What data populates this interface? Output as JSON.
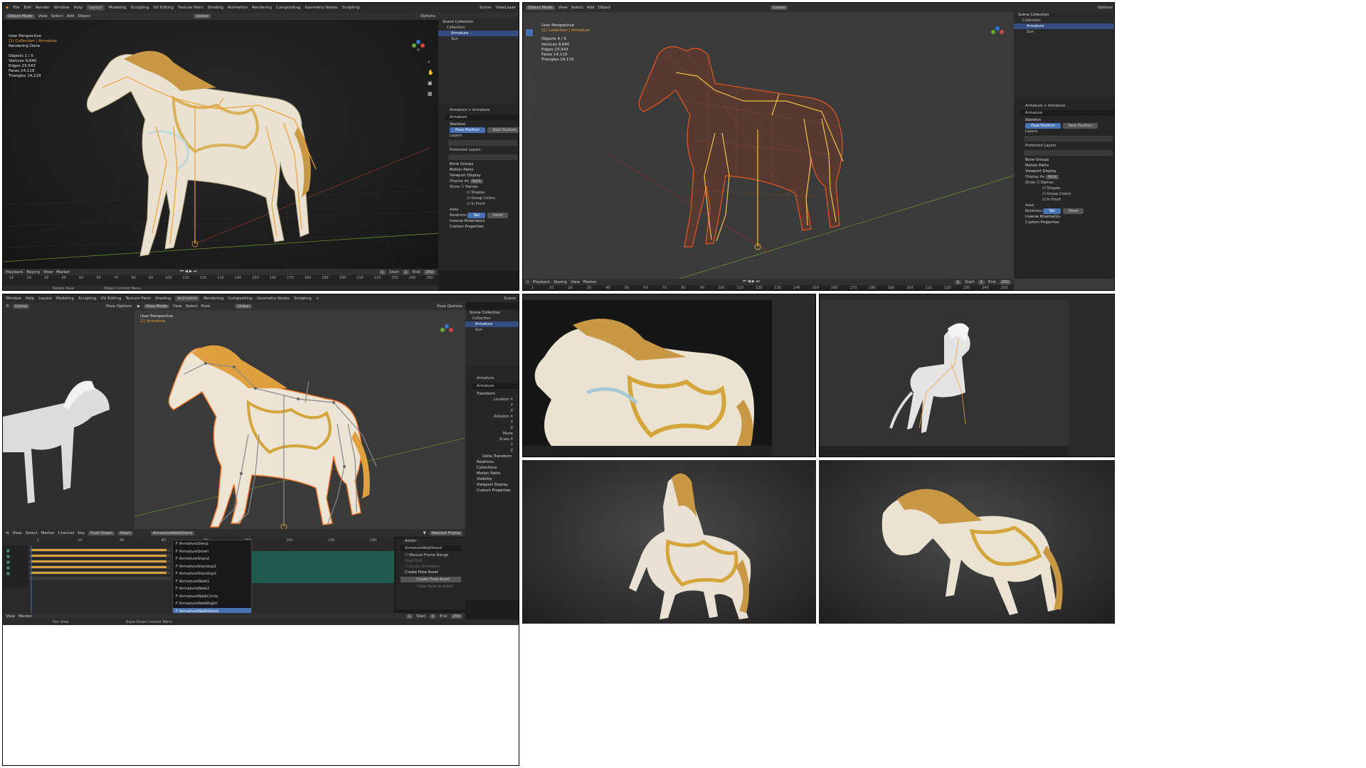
{
  "panel1": {
    "menu": [
      "File",
      "Edit",
      "Render",
      "Window",
      "Help"
    ],
    "workspaces": [
      "Layout",
      "Modeling",
      "Sculpting",
      "UV Editing",
      "Texture Paint",
      "Shading",
      "Animation",
      "Rendering",
      "Compositing",
      "Geometry Nodes",
      "Scripting"
    ],
    "active_workspace": "Layout",
    "scene": "Scene",
    "view_layer": "ViewLayer",
    "mode": "Object Mode",
    "header_items": [
      "View",
      "Select",
      "Add",
      "Object"
    ],
    "orientation": "Global",
    "options": "Options",
    "overlay": {
      "title": "User Perspective",
      "subtitle": "(1) Collection | Armature",
      "status": "Rendering Done",
      "stats": [
        "Objects   1 / 5",
        "Vertices  9,640",
        "Edges    23,543",
        "Faces    14,119",
        "Triangles  14,119"
      ]
    },
    "outliner": [
      "Scene Collection",
      "Collection",
      "Armature",
      "Sun"
    ],
    "props": {
      "breadcrumb": "Armature  >  Armature",
      "name": "Armature",
      "skeleton": "Skeleton",
      "pose_position": "Pose Position",
      "rest_position": "Rest Position",
      "layers": "Layers",
      "protected_layers": "Protected Layers",
      "bone_groups": "Bone Groups",
      "motion_paths": "Motion Paths",
      "viewport_display": "Viewport Display",
      "display_as": "Display As",
      "display_as_value": "Stick",
      "show": "Show",
      "names": "Names",
      "shapes": "Shapes",
      "group_colors": "Group Colors",
      "in_front": "In Front",
      "axes": "Axes",
      "relations": "Relations",
      "tail": "Tail",
      "head": "Head",
      "inverse_kinematics": "Inverse Kinematics",
      "custom_properties": "Custom Properties"
    },
    "timeline_menu": [
      "Playback",
      "Keying",
      "View",
      "Marker"
    ],
    "frame": "1",
    "start_label": "Start",
    "start": "1",
    "end_label": "End",
    "end": "250",
    "ticks": [
      "10",
      "20",
      "30",
      "40",
      "50",
      "60",
      "70",
      "80",
      "90",
      "100",
      "110",
      "120",
      "130",
      "140",
      "150",
      "160",
      "170",
      "180",
      "190",
      "200",
      "210",
      "220",
      "230",
      "240",
      "250"
    ],
    "status_items": [
      "Rotate View",
      "Object Context Menu"
    ]
  },
  "panel2": {
    "mode": "Object Mode",
    "header_items": [
      "View",
      "Select",
      "Add",
      "Object"
    ],
    "orientation": "Global",
    "options": "Options",
    "overlay": {
      "title": "User Perspective",
      "subtitle": "(1) Collection | Armature",
      "stats": [
        "Objects   4 / 5",
        "Vertices  9,640",
        "Edges    23,543",
        "Faces    14,119",
        "Triangles  14,119"
      ]
    },
    "outliner": [
      "Scene Collection",
      "Collection",
      "Armature",
      "Sun"
    ],
    "timeline_menu": [
      "Playback",
      "Keying",
      "View",
      "Marker"
    ],
    "frame": "1",
    "start_label": "Start",
    "start": "1",
    "end_label": "End",
    "end": "250",
    "ticks": [
      "1",
      "10",
      "20",
      "30",
      "40",
      "50",
      "60",
      "70",
      "80",
      "90",
      "100",
      "110",
      "120",
      "130",
      "140",
      "150",
      "160",
      "170",
      "180",
      "190",
      "200",
      "210",
      "220",
      "230",
      "240",
      "250"
    ]
  },
  "panel3": {
    "menu": [
      "Window",
      "Help"
    ],
    "workspaces": [
      "Layout",
      "Modeling",
      "Sculpting",
      "UV Editing",
      "Texture Paint",
      "Shading",
      "Animation",
      "Rendering",
      "Compositing",
      "Geometry Nodes",
      "Scripting"
    ],
    "active_workspace": "Animation",
    "scene": "Scene",
    "orientation": "Global",
    "mode": "Pose Mode",
    "header_items": [
      "View",
      "Select",
      "Pose"
    ],
    "pose_options": "Pose Options",
    "overlay": {
      "title": "User Perspective",
      "subtitle": "(1) Armature"
    },
    "outliner": [
      "Scene Collection",
      "Collection",
      "Armature",
      "Sun"
    ],
    "props": {
      "name": "Armature",
      "transform": "Transform",
      "location_x": "Location X",
      "rotation_x": "Rotation X",
      "mode": "Mode",
      "scale_x": "Scale X",
      "y": "Y",
      "z": "Z",
      "delta_transform": "Delta Transform",
      "relations": "Relations",
      "collections": "Collections",
      "motion_paths": "Motion Paths",
      "visibility": "Visibility",
      "viewport_display": "Viewport Display",
      "custom_properties": "Custom Properties"
    },
    "dopesheet_menu": [
      "View",
      "Select",
      "Marker",
      "Channel",
      "Key"
    ],
    "push_down": "Push Down",
    "stash": "Stash",
    "action_name": "ArmatureWalkStand",
    "snap": "Nearest Frame",
    "ticks": [
      "1",
      "20",
      "40",
      "60",
      "80",
      "180",
      "200",
      "220",
      "240"
    ],
    "actions": [
      "F ArmatureSleep",
      "F ArmatureSmell",
      "F ArmatureStand",
      "F ArmatureStandup1",
      "F ArmatureStandup2",
      "F ArmatureWalk1",
      "F ArmatureWalk2",
      "F ArmatureWalkCircle",
      "F ArmatureWalkRight",
      "F ArmatureWalkStand"
    ],
    "action_panel": {
      "action": "Action",
      "action_value": "ArmatureWalkStand",
      "manual_frame_range": "Manual Frame Range",
      "start": "Start",
      "end": "End",
      "cyclic": "Cyclic Animation",
      "create_pose_asset": "Create Pose Asset",
      "create_pose_asset_btn": "Create Pose Asset",
      "copy_pose": "Copy Pose as Asset"
    },
    "bottom_menu": [
      "View",
      "Marker"
    ],
    "start_label": "Start",
    "start": "1",
    "end_label": "End",
    "end": "250",
    "frame": "1",
    "status_items": [
      "Pan View",
      "Dope Sheet Context Menu"
    ]
  },
  "colors": {
    "accent": "#4772b3",
    "bone": "#f0a030",
    "wire": "#d9481f",
    "gold": "#d4a53a"
  }
}
